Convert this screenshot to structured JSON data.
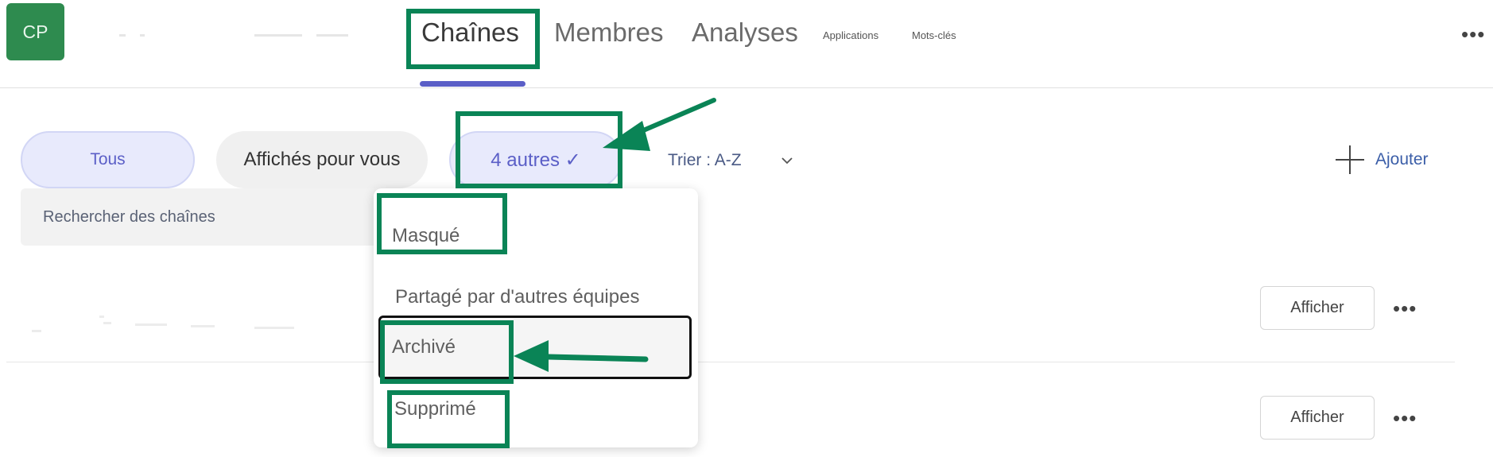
{
  "header": {
    "avatar_initials": "CP",
    "tabs": [
      {
        "label": "Chaînes",
        "active": true
      },
      {
        "label": "Membres",
        "active": false
      },
      {
        "label": "Analyses",
        "active": false
      },
      {
        "label": "Applications",
        "active": false
      },
      {
        "label": "Mots-clés",
        "active": false
      }
    ],
    "more_icon": "more-horizontal-icon"
  },
  "filters": {
    "all_label": "Tous",
    "shown_label": "Affichés pour vous",
    "others_label": "4 autres ✓",
    "sort_label": "Trier : A-Z",
    "add_label": "Ajouter"
  },
  "search": {
    "placeholder": "Rechercher des chaînes"
  },
  "rows": [
    {
      "action_label": "Afficher"
    },
    {
      "action_label": "Afficher"
    }
  ],
  "dropdown": {
    "items": [
      {
        "label": "Masqué"
      },
      {
        "label": "Partagé par d'autres équipes"
      },
      {
        "label": "Archivé",
        "selected": true
      },
      {
        "label": "Supprimé"
      }
    ]
  },
  "colors": {
    "accent": "#5b5fc7",
    "annotation": "#0a8456",
    "avatar": "#2e8b4f"
  }
}
